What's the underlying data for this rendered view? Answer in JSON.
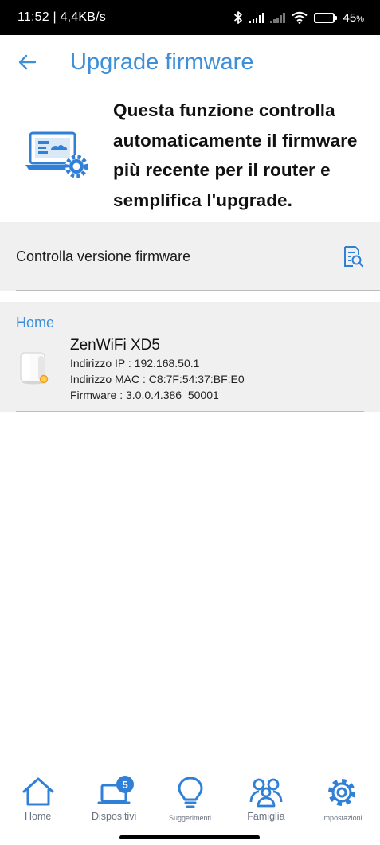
{
  "status_bar": {
    "time_speed": "11:52 | 4,4KB/s",
    "battery_value": "45",
    "battery_unit": "%",
    "battery_level": 0.45
  },
  "header": {
    "title": "Upgrade firmware",
    "back_icon": "arrow-left-icon"
  },
  "intro": {
    "icon": "laptop-gear-icon",
    "text": "Questa funzione controlla automaticamente il firmware più recente per il router e semplifica l'upgrade."
  },
  "check": {
    "label": "Controlla versione firmware",
    "icon": "document-search-icon"
  },
  "devices": {
    "section_label": "Home",
    "items": [
      {
        "name": "ZenWiFi XD5",
        "ip": "Indirizzo IP : 192.168.50.1",
        "mac": "Indirizzo MAC : C8:7F:54:37:BF:E0",
        "firmware": "Firmware : 3.0.0.4.386_50001"
      }
    ]
  },
  "nav": {
    "items": [
      {
        "label": "Home",
        "icon": "home-icon"
      },
      {
        "label": "Dispositivi",
        "icon": "devices-icon",
        "badge": "5"
      },
      {
        "label": "Suggerimenti",
        "icon": "lightbulb-icon"
      },
      {
        "label": "Famiglia",
        "icon": "family-icon"
      },
      {
        "label": "Impostazioni",
        "icon": "gear-icon"
      }
    ]
  },
  "colors": {
    "accent": "#3d8fd9",
    "section_bg": "#f0f0f0",
    "badge": "#2f80d6"
  }
}
